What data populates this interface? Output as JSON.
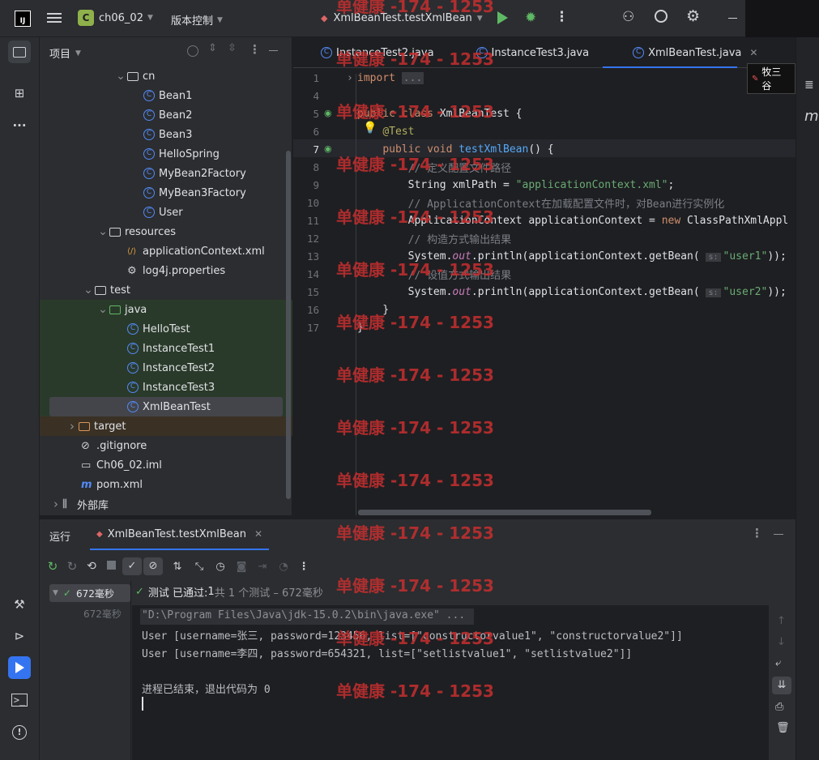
{
  "titlebar": {
    "project_badge": "C",
    "project": "ch06_02",
    "vcs": "版本控制",
    "run_config": "XmlBeanTest.testXmlBean",
    "logo": "IJ"
  },
  "project_panel": {
    "title": "项目"
  },
  "tree": [
    {
      "label": "cn",
      "icon": "folder",
      "indent": 1,
      "chevron": "down"
    },
    {
      "label": "Bean1",
      "icon": "class",
      "indent": 3
    },
    {
      "label": "Bean2",
      "icon": "class",
      "indent": 3
    },
    {
      "label": "Bean3",
      "icon": "class",
      "indent": 3
    },
    {
      "label": "HelloSpring",
      "icon": "class",
      "indent": 3
    },
    {
      "label": "MyBean2Factory",
      "icon": "class",
      "indent": 3
    },
    {
      "label": "MyBean3Factory",
      "icon": "class",
      "indent": 3
    },
    {
      "label": "User",
      "icon": "class",
      "indent": 3
    },
    {
      "label": "resources",
      "icon": "folder",
      "indent": 0,
      "chevron": "down"
    },
    {
      "label": "applicationContext.xml",
      "icon": "xml",
      "indent": 2
    },
    {
      "label": "log4j.properties",
      "icon": "gear",
      "indent": 2
    },
    {
      "label": "test",
      "icon": "folder",
      "indent": -1,
      "chevron": "down"
    },
    {
      "label": "java",
      "icon": "folder",
      "indent": 0,
      "chevron": "down"
    },
    {
      "label": "HelloTest",
      "icon": "class",
      "indent": 2
    },
    {
      "label": "InstanceTest1",
      "icon": "class",
      "indent": 2
    },
    {
      "label": "InstanceTest2",
      "icon": "class",
      "indent": 2
    },
    {
      "label": "InstanceTest3",
      "icon": "class",
      "indent": 2
    },
    {
      "label": "XmlBeanTest",
      "icon": "class",
      "indent": 2,
      "selected": true
    },
    {
      "label": "target",
      "icon": "folder",
      "indent": -2,
      "chevron": "right"
    },
    {
      "label": ".gitignore",
      "icon": "ignore",
      "indent": -1
    },
    {
      "label": "Ch06_02.iml",
      "icon": "file",
      "indent": -1
    },
    {
      "label": "pom.xml",
      "icon": "maven",
      "indent": -1
    },
    {
      "label": "外部库",
      "icon": "library",
      "indent": -3,
      "chevron": "right"
    }
  ],
  "editor": {
    "tabs": [
      {
        "label": "InstanceTest2.java"
      },
      {
        "label": "InstanceTest3.java"
      },
      {
        "label": "XmlBeanTest.java",
        "active": true
      }
    ],
    "user_tag": "牧三谷",
    "lines": [
      {
        "n": "1",
        "t": [
          [
            "kw",
            "import "
          ],
          [
            "cm",
            "..."
          ]
        ]
      },
      {
        "n": "4",
        "t": []
      },
      {
        "n": "5",
        "t": [
          [
            "kw",
            "public class "
          ],
          [
            "",
            "XmlBeanTest {"
          ]
        ]
      },
      {
        "n": "6",
        "t": [
          [
            "",
            "    "
          ],
          [
            "an",
            "@Test"
          ]
        ]
      },
      {
        "n": "7",
        "t": [
          [
            "",
            "    "
          ],
          [
            "kw",
            "public void "
          ],
          [
            "fn",
            "testXmlBean"
          ],
          [
            "",
            "() {"
          ]
        ]
      },
      {
        "n": "8",
        "t": [
          [
            "",
            "        "
          ],
          [
            "cm",
            "// 定义配置文件路径"
          ]
        ]
      },
      {
        "n": "9",
        "t": [
          [
            "",
            "        String xmlPath = "
          ],
          [
            "str",
            "\"applicationContext.xml\""
          ],
          [
            "",
            ";"
          ]
        ]
      },
      {
        "n": "10",
        "t": [
          [
            "",
            "        "
          ],
          [
            "cm",
            "// ApplicationContext在加载配置文件时，对Bean进行实例化"
          ]
        ]
      },
      {
        "n": "11",
        "t": [
          [
            "",
            "        ApplicationContext applicationContext = "
          ],
          [
            "kw",
            "new "
          ],
          [
            "",
            "ClassPathXmlAppl"
          ]
        ]
      },
      {
        "n": "12",
        "t": [
          [
            "",
            "        "
          ],
          [
            "cm",
            "// 构造方式输出结果"
          ]
        ]
      },
      {
        "n": "13",
        "t": [
          [
            "",
            "        System."
          ],
          [
            "it",
            "out"
          ],
          [
            "",
            ".println(applicationContext.getBean( "
          ],
          [
            "cm",
            "s:"
          ],
          [
            "str",
            "\"user1\""
          ],
          [
            "",
            "));"
          ]
        ]
      },
      {
        "n": "14",
        "t": [
          [
            "",
            "        "
          ],
          [
            "cm",
            "// 设值方式输出结果"
          ]
        ]
      },
      {
        "n": "15",
        "t": [
          [
            "",
            "        System."
          ],
          [
            "it",
            "out"
          ],
          [
            "",
            ".println(applicationContext.getBean( "
          ],
          [
            "cm",
            "s:"
          ],
          [
            "str",
            "\"user2\""
          ],
          [
            "",
            "));"
          ]
        ]
      },
      {
        "n": "16",
        "t": [
          [
            "",
            "    }"
          ]
        ]
      },
      {
        "n": "17",
        "t": [
          [
            "",
            "}"
          ]
        ]
      }
    ]
  },
  "run": {
    "tab_run": "运行",
    "tab_config": "XmlBeanTest.testXmlBean",
    "test_time": "672毫秒",
    "test_time2": "672毫秒",
    "status_pass": "测试 已通过: ",
    "status_count": "1",
    "status_rest": "共 1 个测试 – 672毫秒",
    "console": [
      "\"D:\\Program Files\\Java\\jdk-15.0.2\\bin\\java.exe\" ...",
      "User [username=张三, password=123456, list=[\"constructorvalue1\", \"constructorvalue2\"]]",
      "User [username=李四, password=654321, list=[\"setlistvalue1\", \"setlistvalue2\"]]",
      "",
      "进程已结束，退出代码为 0"
    ]
  },
  "watermark": "单健康 -174 - 1253",
  "colors": {
    "accent": "#3574f0",
    "pass": "#5fb865",
    "bg": "#1e1f22",
    "panel": "#2b2d30"
  }
}
